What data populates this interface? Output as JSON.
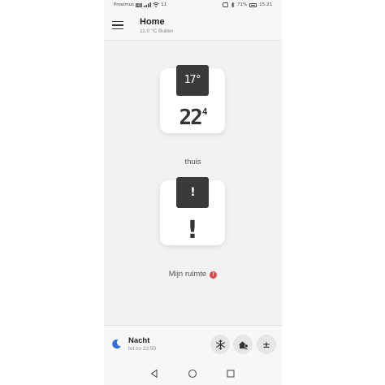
{
  "status_bar": {
    "carrier": "Proximus",
    "carrier_tag": "HD",
    "signal_text": "11",
    "battery": "71%",
    "time": "15:21"
  },
  "header": {
    "title": "Home",
    "subtitle": "11.0 °C Buiten",
    "menu_icon": "hamburger-menu-icon"
  },
  "devices": [
    {
      "setpoint": "17",
      "setpoint_unit": "°",
      "temperature": "22",
      "temperature_decimal": "4",
      "room": "thuis"
    },
    {
      "tab_symbol": "!",
      "main_symbol": "!",
      "room": "Mijn ruimte",
      "error_badge": "!"
    }
  ],
  "mode": {
    "icon": "moon-icon",
    "title": "Nacht",
    "subtitle": "tot zo 23:59"
  },
  "actions": [
    {
      "icon": "snowflake-icon"
    },
    {
      "icon": "home-away-icon"
    },
    {
      "label": "±"
    }
  ],
  "nav": [
    "back-icon",
    "home-icon",
    "recents-icon"
  ],
  "colors": {
    "accent": "#3a3a3a",
    "error": "#e04848",
    "moon": "#2f6fd6"
  }
}
